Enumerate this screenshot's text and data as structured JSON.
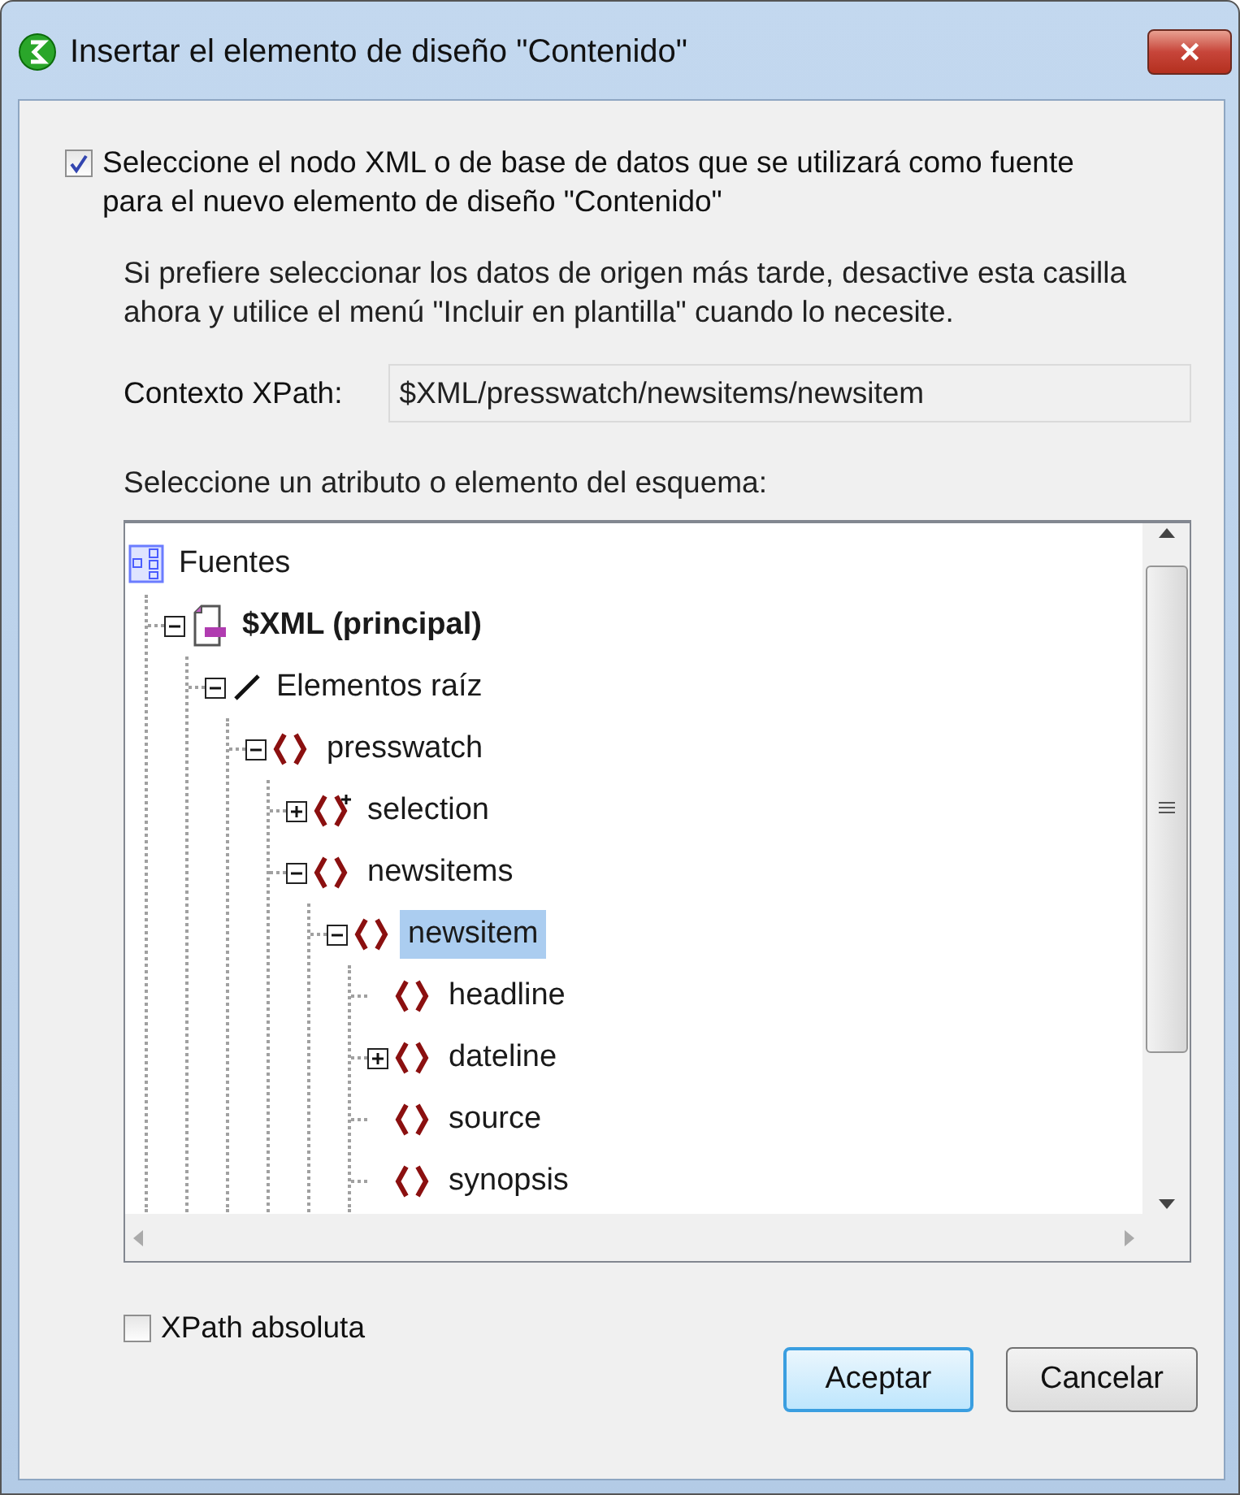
{
  "window": {
    "title": "Insertar el elemento de diseño \"Contenido\"",
    "close": "✕"
  },
  "source_checkbox": {
    "label": "Seleccione el nodo XML o de base de datos que se utilizará como fuente para el nuevo elemento de diseño \"Contenido\"",
    "checked": true
  },
  "hint": "Si prefiere seleccionar los datos de origen más tarde, desactive esta casilla ahora y utilice el menú \"Incluir en plantilla\" cuando lo necesite.",
  "context": {
    "label": "Contexto XPath:",
    "value": "$XML/presswatch/newsitems/newsitem"
  },
  "tree_label": "Seleccione un atributo o elemento del esquema:",
  "tree": [
    {
      "label": "Fuentes",
      "kind": "sources",
      "selected": false,
      "children": [
        {
          "label": "$XML (principal)",
          "kind": "document",
          "expanded": true,
          "selected": false,
          "children": [
            {
              "label": "Elementos raíz",
              "kind": "root",
              "expanded": true,
              "selected": false,
              "children": [
                {
                  "label": "presswatch",
                  "kind": "element",
                  "expanded": true,
                  "selected": false,
                  "children": [
                    {
                      "label": "selection",
                      "kind": "element-plus",
                      "expanded": false,
                      "selected": false
                    },
                    {
                      "label": "newsitems",
                      "kind": "element",
                      "expanded": true,
                      "selected": false,
                      "children": [
                        {
                          "label": "newsitem",
                          "kind": "element",
                          "expanded": true,
                          "selected": true,
                          "children": [
                            {
                              "label": "headline",
                              "kind": "element",
                              "selected": false
                            },
                            {
                              "label": "dateline",
                              "kind": "element",
                              "expanded": false,
                              "selected": false
                            },
                            {
                              "label": "source",
                              "kind": "element",
                              "selected": false
                            },
                            {
                              "label": "synopsis",
                              "kind": "element",
                              "selected": false
                            }
                          ]
                        }
                      ]
                    }
                  ]
                }
              ]
            }
          ]
        }
      ]
    }
  ],
  "absolute_checkbox": {
    "label": "XPath absoluta",
    "checked": false
  },
  "buttons": [
    {
      "label": "Aceptar",
      "default": true
    },
    {
      "label": "Cancelar",
      "default": false
    }
  ]
}
